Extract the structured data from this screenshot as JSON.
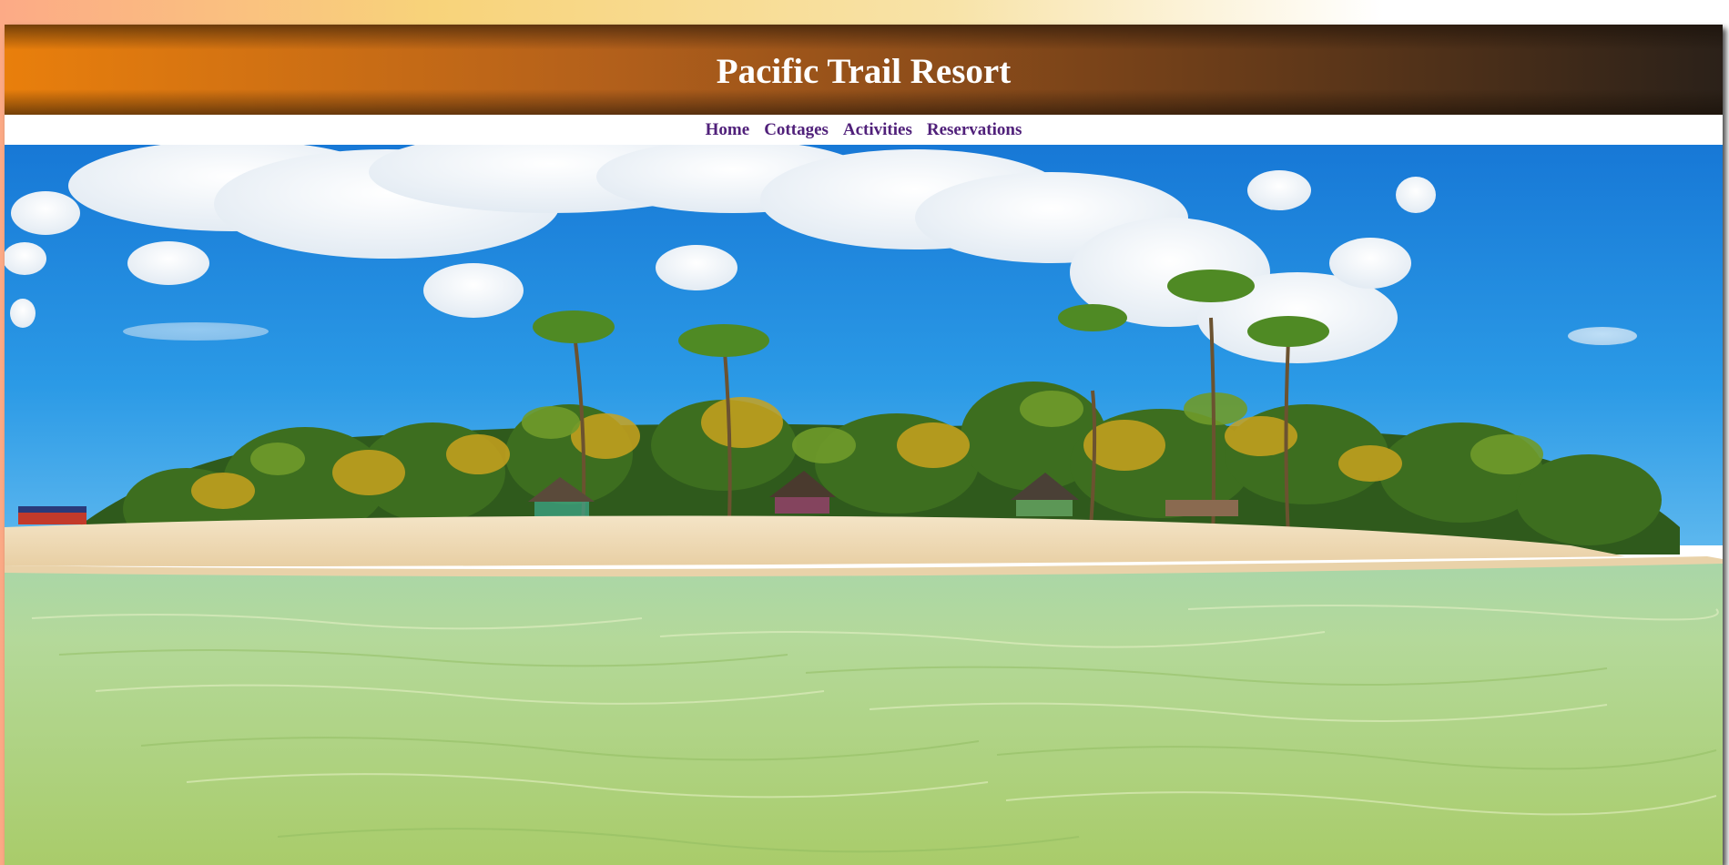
{
  "site": {
    "title": "Pacific Trail Resort"
  },
  "nav": {
    "items": [
      {
        "label": "Home"
      },
      {
        "label": "Cottages"
      },
      {
        "label": "Activities"
      },
      {
        "label": "Reservations"
      }
    ]
  },
  "hero": {
    "image_icon": "tropical-beach-image"
  },
  "colors": {
    "header_start": "#e97f0c",
    "header_end": "#2b2119",
    "nav_link": "#50207a",
    "sky": "#1e8ee0",
    "sand": "#efdcb8",
    "water": "#b7d98e"
  }
}
